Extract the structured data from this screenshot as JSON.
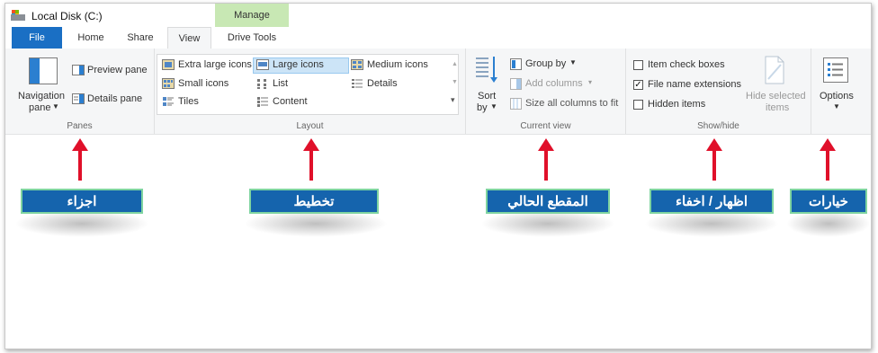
{
  "window": {
    "title": "Local Disk (C:)"
  },
  "context_tab": {
    "label": "Manage"
  },
  "tabs": {
    "file": "File",
    "home": "Home",
    "share": "Share",
    "view": "View",
    "drive_tools": "Drive Tools"
  },
  "panes": {
    "navigation_pane": "Navigation",
    "navigation_pane_2": "pane",
    "preview_pane": "Preview pane",
    "details_pane": "Details pane",
    "group_label": "Panes"
  },
  "layout": {
    "items": {
      "extra_large": "Extra large icons",
      "large": "Large icons",
      "medium": "Medium icons",
      "small": "Small icons",
      "list": "List",
      "details": "Details",
      "tiles": "Tiles",
      "content": "Content"
    },
    "selected": "Large icons",
    "group_label": "Layout"
  },
  "current_view": {
    "sort_by": "Sort",
    "sort_by_2": "by",
    "group_by": "Group by",
    "add_columns": "Add columns",
    "size_all": "Size all columns to fit",
    "group_label": "Current view"
  },
  "show_hide": {
    "item_check_boxes": "Item check boxes",
    "file_name_extensions": "File name extensions",
    "hidden_items": "Hidden items",
    "item_check_boxes_checked": false,
    "file_name_extensions_checked": true,
    "hidden_items_checked": false,
    "hide_selected": "Hide selected",
    "hide_selected_2": "items",
    "group_label": "Show/hide"
  },
  "options": {
    "label": "Options",
    "group_label": ""
  },
  "annotations": {
    "panes": "اجزاء",
    "layout": "تخطيط",
    "current_view": "المقطع الحالي",
    "show_hide": "اظهار / اخفاء",
    "options": "خيارات"
  },
  "colors": {
    "file_tab": "#1a6fc4",
    "manage_tab": "#c8e8b4",
    "arrow": "#e0102a",
    "label_bg": "#1564ad",
    "label_border": "#7fd4a0"
  }
}
